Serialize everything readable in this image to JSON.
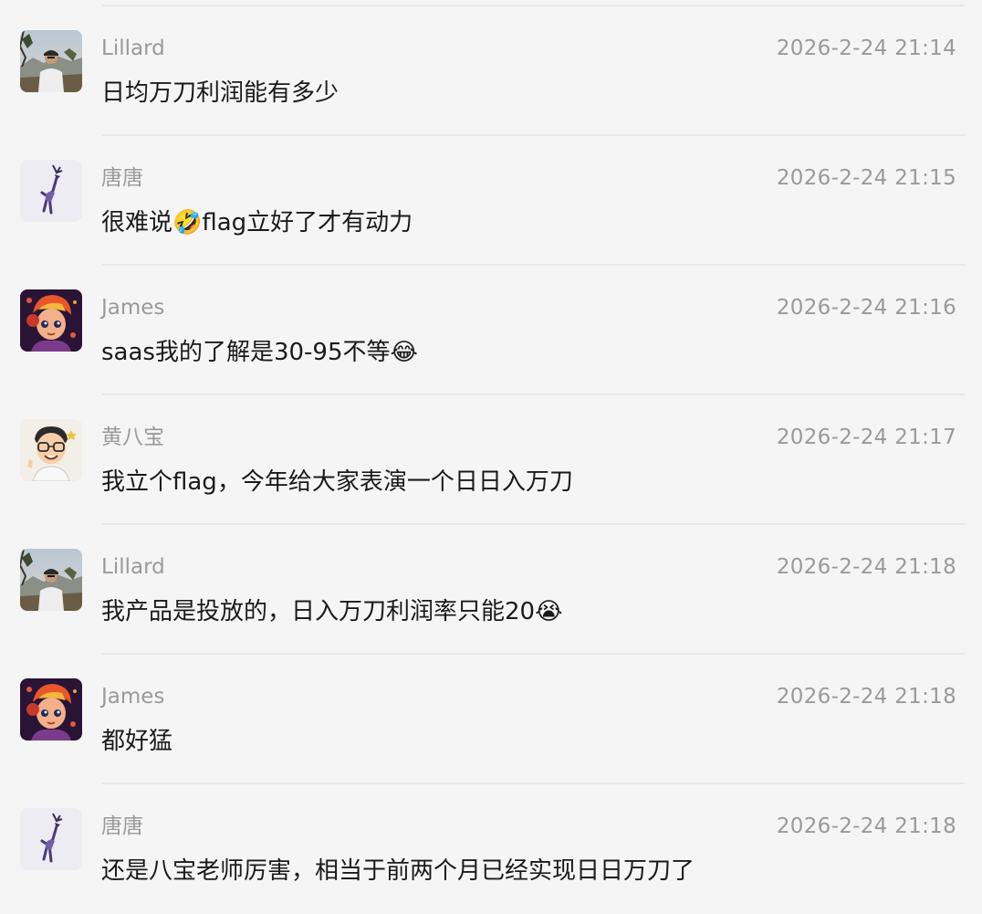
{
  "messages": [
    {
      "name": "Lillard",
      "time": "2026-2-24 21:14",
      "text": "日均万刀利润能有多少",
      "avatar": "mountain-photo"
    },
    {
      "name": "唐唐",
      "time": "2026-2-24 21:15",
      "text": "很难说🤣flag立好了才有动力",
      "avatar": "deer-art"
    },
    {
      "name": "James",
      "time": "2026-2-24 21:16",
      "text": "saas我的了解是30-95不等😂",
      "avatar": "anime-character"
    },
    {
      "name": "黄八宝",
      "time": "2026-2-24 21:17",
      "text": "我立个flag，今年给大家表演一个日日入万刀",
      "avatar": "cartoon-man"
    },
    {
      "name": "Lillard",
      "time": "2026-2-24 21:18",
      "text": "我产品是投放的，日入万刀利润率只能20😭",
      "avatar": "mountain-photo"
    },
    {
      "name": "James",
      "time": "2026-2-24 21:18",
      "text": "都好猛",
      "avatar": "anime-character"
    },
    {
      "name": "唐唐",
      "time": "2026-2-24 21:18",
      "text": "还是八宝老师厉害，相当于前两个月已经实现日日万刀了",
      "avatar": "deer-art"
    }
  ]
}
